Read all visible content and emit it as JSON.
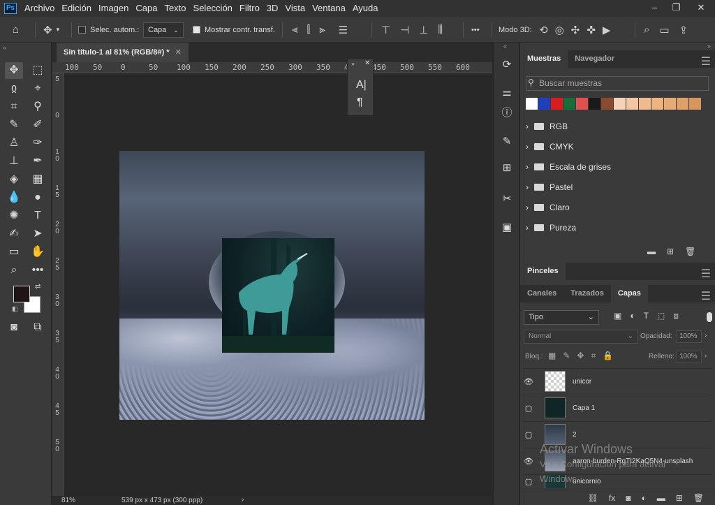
{
  "app": {
    "logo": "Ps"
  },
  "menu": [
    "Archivo",
    "Edición",
    "Imagen",
    "Capa",
    "Texto",
    "Selección",
    "Filtro",
    "3D",
    "Vista",
    "Ventana",
    "Ayuda"
  ],
  "window_controls": {
    "minimize": "–",
    "restore": "❐",
    "close": "✕"
  },
  "options": {
    "auto_select_label": "Selec. autom.:",
    "auto_select_target": "Capa",
    "show_transform_label": "Mostrar contr. transf.",
    "more": "•••",
    "mode3d_label": "Modo 3D:"
  },
  "document": {
    "tab_title": "Sin título-1 al 81% (RGB/8#) *",
    "zoom": "81%",
    "size": "539 px x 473 px (300 ppp)"
  },
  "ruler": {
    "h_ticks": [
      "100",
      "50",
      "0",
      "50",
      "100",
      "150",
      "200",
      "250",
      "300",
      "350",
      "400",
      "450",
      "500",
      "550",
      "600"
    ],
    "v_ticks": [
      "5",
      "0",
      "1 0",
      "1 5",
      "2 0",
      "2 5",
      "3 0",
      "3 5",
      "4 0",
      "4 5",
      "5 0"
    ]
  },
  "float_panel": {
    "char": "A|",
    "para": "¶"
  },
  "swatches_panel": {
    "tabs": [
      "Muestras",
      "Navegador"
    ],
    "search_placeholder": "Buscar muestras",
    "swatches": [
      "#ffffff",
      "#1e40ba",
      "#d71e1e",
      "#1a6d3a",
      "#e05050",
      "#1a1a1a",
      "#8c4a2e",
      "#f6d2b8",
      "#f2c6a2",
      "#eeba8e",
      "#ecb481",
      "#e6aa74",
      "#dfa06a",
      "#d8965f"
    ],
    "groups": [
      "RGB",
      "CMYK",
      "Escala de grises",
      "Pastel",
      "Claro",
      "Pureza"
    ]
  },
  "brushes_panel": {
    "title": "Pinceles"
  },
  "layers_panel": {
    "tabs": [
      "Canales",
      "Trazados",
      "Capas"
    ],
    "filter_label": "Tipo",
    "blend_mode": "Normal",
    "opacity_label": "Opacidad:",
    "opacity": "100%",
    "lock_label": "Bloq.:",
    "fill_label": "Relleno:",
    "fill": "100%",
    "layers": [
      {
        "name": "unicor",
        "visible": true
      },
      {
        "name": "Capa 1",
        "visible": false
      },
      {
        "name": "2",
        "visible": false
      },
      {
        "name": "aaron-burden-RgTI2KaQ5N4-unsplash",
        "visible": true
      },
      {
        "name": "unicornio",
        "visible": false
      }
    ]
  },
  "watermark": {
    "line1": "Activar Windows",
    "line2": "Ve a Configuración para activar",
    "line3": "Windows."
  }
}
